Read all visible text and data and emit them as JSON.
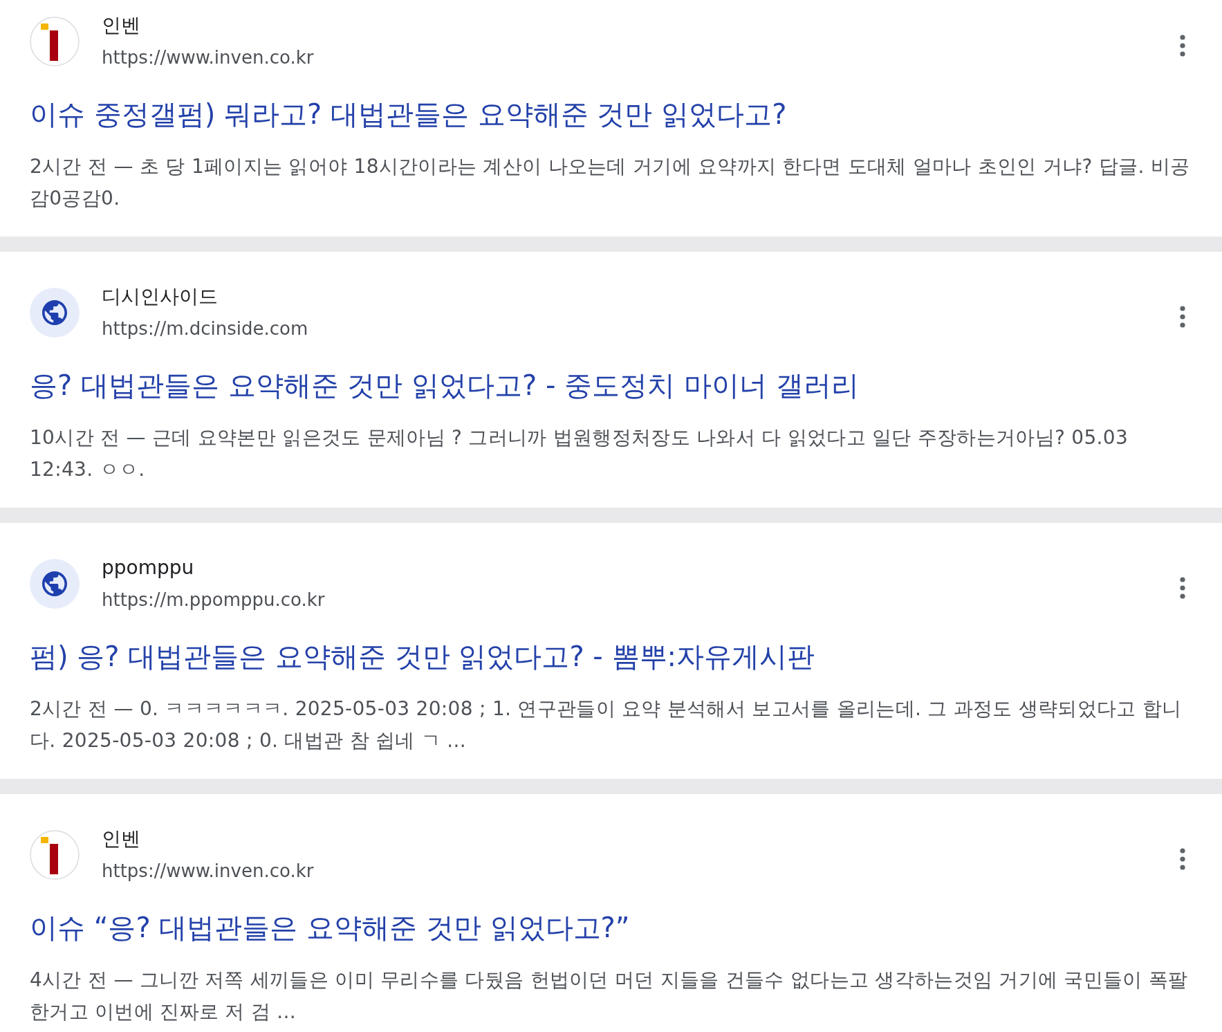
{
  "results": [
    {
      "favicon": {
        "kind": "logo"
      },
      "site_name": "인벤",
      "url": "https://www.inven.co.kr",
      "title": "이슈 중정갤펌) 뭐라고? 대법관들은 요약해준 것만 읽었다고?",
      "snippet": "2시간 전 — 초 당 1페이지는 읽어야 18시간이라는 계산이 나오는데 거기에 요약까지 한다면 도대체 얼마나 초인인 거냐? 답글. 비공감0공감0."
    },
    {
      "favicon": {
        "kind": "globe"
      },
      "site_name": "디시인사이드",
      "url": "https://m.dcinside.com",
      "title": "응? 대법관들은 요약해준 것만 읽었다고? - 중도정치 마이너 갤러리",
      "snippet": "10시간 전 — 근데 요약본만 읽은것도 문제아님 ? 그러니까 법원행정처장도 나와서 다 읽었다고 일단 주장하는거아님? 05.03 12:43. ㅇㅇ."
    },
    {
      "favicon": {
        "kind": "globe"
      },
      "site_name": "ppomppu",
      "url": "https://m.ppomppu.co.kr",
      "title": "펌) 응? 대법관들은 요약해준 것만 읽었다고? - 뽐뿌:자유게시판",
      "snippet": "2시간 전 — 0. ㅋㅋㅋㅋㅋㅋ. 2025-05-03 20:08 ; 1. 연구관들이 요약 분석해서 보고서를 올리는데. 그 과정도 생략되었다고 합니다. 2025-05-03 20:08 ; 0. 대법관 참 쉽네 ㄱ ..."
    },
    {
      "favicon": {
        "kind": "logo"
      },
      "site_name": "인벤",
      "url": "https://www.inven.co.kr",
      "title": "이슈 “응? 대법관들은 요약해준 것만 읽었다고?”",
      "snippet": "4시간 전 — 그니깐 저쪽 세끼들은 이미 무리수를 다뒀음 헌법이던 머던 지들을 건들수 없다는고 생각하는것임 거기에 국민들이 폭팔한거고 이번에 진짜로 저 검 ..."
    }
  ]
}
